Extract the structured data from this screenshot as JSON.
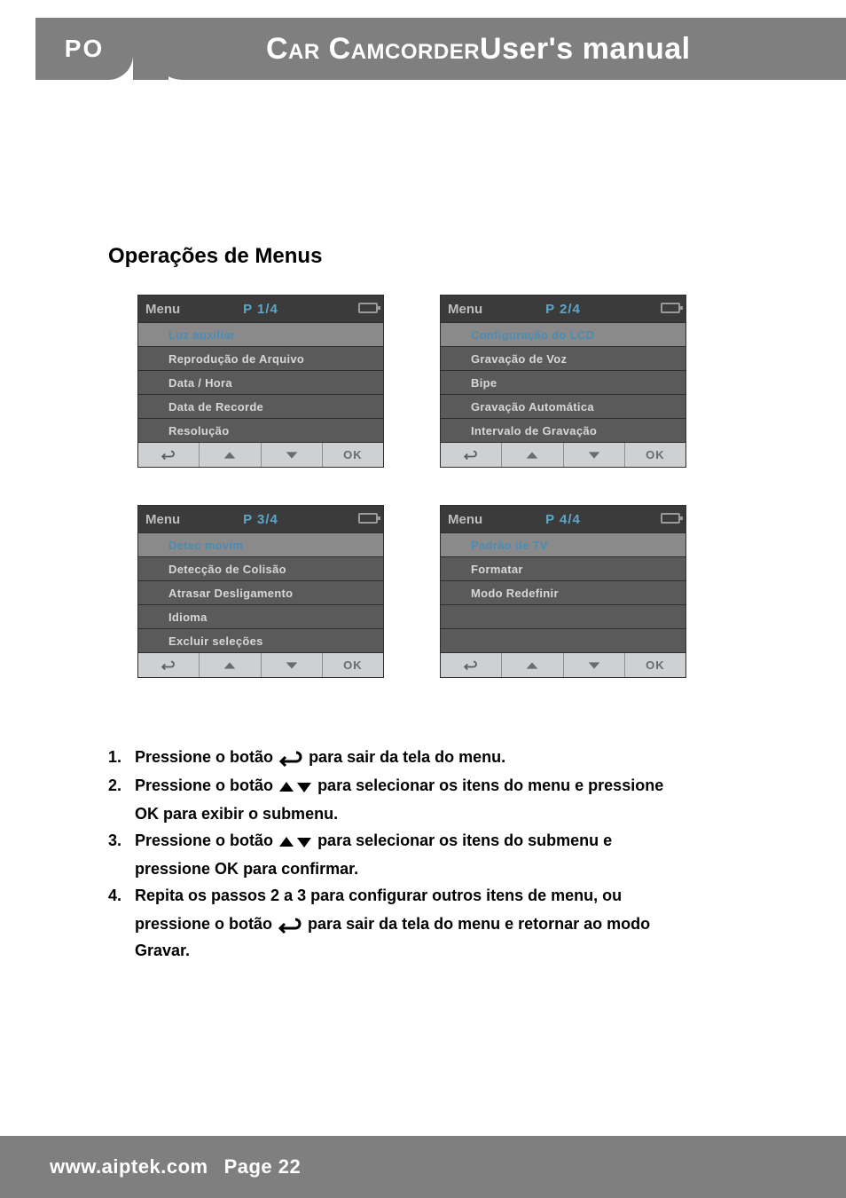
{
  "header": {
    "lang_badge": "PO",
    "title_strong": "Car Camcorder",
    "title_rest": " User's manual"
  },
  "section_title": "Operações de Menus",
  "menus": [
    {
      "label": "Menu",
      "page": "P 1/4",
      "rows": [
        "Luz auxiliar",
        "Reprodução de Arquivo",
        "Data / Hora",
        "Data de Recorde",
        "Resolução"
      ],
      "selected": 0
    },
    {
      "label": "Menu",
      "page": "P 2/4",
      "rows": [
        "Configuração do LCD",
        "Gravação de Voz",
        "Bipe",
        "Gravação Automática",
        "Intervalo de Gravação"
      ],
      "selected": 0
    },
    {
      "label": "Menu",
      "page": "P 3/4",
      "rows": [
        "Detec movim",
        "Detecção de Colisão",
        "Atrasar Desligamento",
        "Idioma",
        "Excluir seleções"
      ],
      "selected": 0
    },
    {
      "label": "Menu",
      "page": "P 4/4",
      "rows": [
        "Padrão de TV",
        "Formatar",
        "Modo Redefinir",
        "",
        ""
      ],
      "selected": 0
    }
  ],
  "menu_footer_ok": "OK",
  "instructions": {
    "i1_a": "Pressione o botão ",
    "i1_b": " para sair da tela do menu.",
    "i2_a": "Pressione o botão ",
    "i2_b": " para selecionar os itens do menu e pressione",
    "i2_c": " para exibir o submenu.",
    "i3_a": "Pressione o botão ",
    "i3_b": " para selecionar os itens do submenu e",
    "i3_c": "pressione ",
    "i3_d": " para confirmar.",
    "i4_a": "Repita os passos 2 a 3 para configurar outros itens de menu, ou",
    "i4_b": "pressione o botão ",
    "i4_c": " para sair da tela do menu e retornar ao modo",
    "i4_d": "Gravar.",
    "ok_glyph_1": "OK",
    "ok_glyph_2": "OK"
  },
  "footer": {
    "site": "www.aiptek.com",
    "page": "Page 22"
  }
}
